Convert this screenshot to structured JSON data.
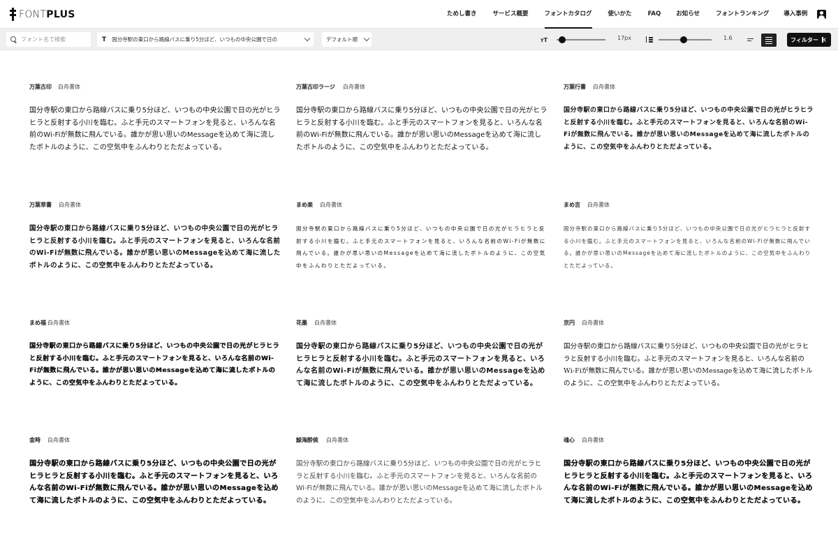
{
  "header": {
    "logo_left": "FONT",
    "logo_right": "PLUS",
    "nav": [
      {
        "label": "ためし書き",
        "active": false
      },
      {
        "label": "サービス概要",
        "active": false
      },
      {
        "label": "フォントカタログ",
        "active": true
      },
      {
        "label": "使いかた",
        "active": false
      },
      {
        "label": "FAQ",
        "active": false
      },
      {
        "label": "お知らせ",
        "active": false
      },
      {
        "label": "フォントランキング",
        "active": false
      },
      {
        "label": "導入事例",
        "active": false
      }
    ]
  },
  "toolbar": {
    "search_placeholder": "フォント名で検索",
    "sample_text": "国分寺駅の東口から路線バスに乗り5分ほど、いつもの中央公園で日の",
    "sort_label": "デフォルト順",
    "font_size_value": "17px",
    "font_size_level": 0.12,
    "line_height_value": "1.6",
    "line_height_level": 0.48,
    "filter_label": "フィルター"
  },
  "sample_paragraph": "国分寺駅の東口から路線バスに乗り5分ほど、いつもの中央公園で日の光がヒラヒラと反射する小川を臨む。ふと手元のスマートフォンを見ると、いろんな名前のWi-Fiが無数に飛んでいる。誰かが思い思いのMessageを込めて海に流したボトルのように、この空気中をふんわりとただよっている。",
  "cards": [
    {
      "name": "万葉古印",
      "vendor": "白舟書体"
    },
    {
      "name": "万葉古印ラージ",
      "vendor": "白舟書体"
    },
    {
      "name": "万葉行書",
      "vendor": "白舟書体"
    },
    {
      "name": "万葉草書",
      "vendor": "白舟書体"
    },
    {
      "name": "まめ楽",
      "vendor": "白舟書体"
    },
    {
      "name": "まめ吉",
      "vendor": "白舟書体"
    },
    {
      "name": "まめ福",
      "vendor": "白舟書体"
    },
    {
      "name": "花墨",
      "vendor": "白舟書体"
    },
    {
      "name": "京円",
      "vendor": "白舟書体"
    },
    {
      "name": "金時",
      "vendor": "白舟書体"
    },
    {
      "name": "鯨海酔侯",
      "vendor": "白舟書体"
    },
    {
      "name": "魂心",
      "vendor": "白舟書体"
    }
  ]
}
